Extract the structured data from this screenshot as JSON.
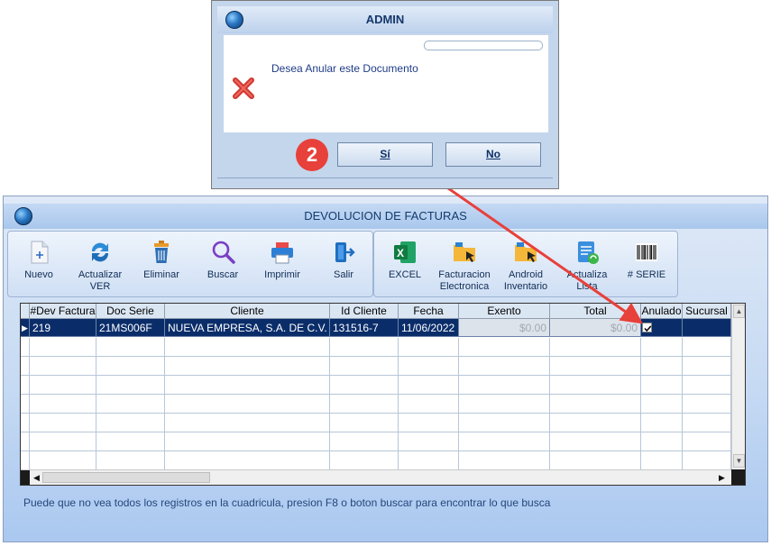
{
  "dialog": {
    "title": "ADMIN",
    "message": "Desea Anular este Documento",
    "yes_label": "Sí",
    "no_label": "No",
    "progress": 0
  },
  "annotation": {
    "step": "2"
  },
  "window": {
    "title": "DEVOLUCION DE FACTURAS"
  },
  "toolbar_left": [
    {
      "label1": "Nuevo",
      "label2": "",
      "icon": "document-add-icon"
    },
    {
      "label1": "Actualizar",
      "label2": "VER",
      "icon": "refresh-icon"
    },
    {
      "label1": "Eliminar",
      "label2": "",
      "icon": "trash-icon"
    },
    {
      "label1": "Buscar",
      "label2": "",
      "icon": "magnifier-icon"
    },
    {
      "label1": "Imprimir",
      "label2": "",
      "icon": "printer-icon"
    },
    {
      "label1": "Salir",
      "label2": "",
      "icon": "exit-door-icon"
    }
  ],
  "toolbar_right": [
    {
      "label1": "EXCEL",
      "label2": "",
      "icon": "excel-icon"
    },
    {
      "label1": "Facturacion",
      "label2": "Electronica",
      "icon": "folder-cursor-icon"
    },
    {
      "label1": "Android",
      "label2": "Inventario",
      "icon": "folder-cursor-icon"
    },
    {
      "label1": "Actualiza",
      "label2": "Lista",
      "icon": "list-refresh-icon"
    },
    {
      "label1": "# SERIE",
      "label2": "",
      "icon": "barcode-icon"
    }
  ],
  "grid": {
    "columns": [
      "#Dev Factura",
      "Doc Serie",
      "Cliente",
      "Id Cliente",
      "Fecha",
      "Exento",
      "Total",
      "Anulado",
      "Sucursal"
    ],
    "rows": [
      {
        "dev": "219",
        "serie": "21MS006F",
        "cliente": "NUEVA EMPRESA, S.A. DE C.V.",
        "id": "131516-7",
        "fecha": "11/06/2022",
        "exento": "$0.00",
        "total": "$0.00",
        "anulado": true,
        "sucursal": ""
      }
    ]
  },
  "status_text": "Puede que no vea todos los registros en la cuadricula, presion F8 o boton buscar para encontrar lo que busca",
  "colors": {
    "accent": "#0a2d6a",
    "annotation": "#e8403a"
  }
}
